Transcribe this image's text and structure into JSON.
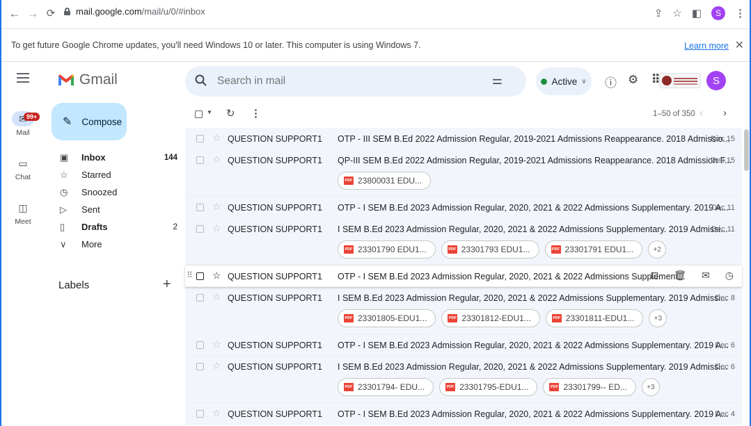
{
  "browser": {
    "url_host": "mail.google.com",
    "url_path": "/mail/u/0/#inbox",
    "profile_initial": "S"
  },
  "infobar": {
    "message": "To get future Google Chrome updates, you'll need Windows 10 or later. This computer is using Windows 7.",
    "learn_more": "Learn more"
  },
  "header": {
    "app_name": "Gmail",
    "search_placeholder": "Search in mail",
    "status": "Active",
    "avatar_initial": "S"
  },
  "rail": {
    "mail_label": "Mail",
    "mail_badge": "99+",
    "chat_label": "Chat",
    "meet_label": "Meet"
  },
  "sidebar": {
    "compose": "Compose",
    "items": [
      {
        "label": "Inbox",
        "count": "144",
        "icon": "inbox-icon"
      },
      {
        "label": "Starred",
        "count": "",
        "icon": "star-icon"
      },
      {
        "label": "Snoozed",
        "count": "",
        "icon": "clock-icon"
      },
      {
        "label": "Sent",
        "count": "",
        "icon": "send-icon"
      },
      {
        "label": "Drafts",
        "count": "2",
        "icon": "draft-icon"
      },
      {
        "label": "More",
        "count": "",
        "icon": "chevron-down-icon"
      }
    ],
    "labels_heading": "Labels"
  },
  "toolbar": {
    "page_count": "1–50 of 350"
  },
  "emails": [
    {
      "sender": "QUESTION SUPPORT1",
      "subject": "OTP - III SEM B.Ed 2022 Admission Regular, 2019-2021 Admissions Reappearance. 2018 Admissio...",
      "date": "Dec 15",
      "attachments": [],
      "more": ""
    },
    {
      "sender": "QUESTION SUPPORT1",
      "subject": "QP-III SEM B.Ed 2022 Admission Regular, 2019-2021 Admissions Reappearance. 2018 Admission F...",
      "date": "Dec 15",
      "attachments": [
        "23800031 EDU..."
      ],
      "more": ""
    },
    {
      "sender": "QUESTION SUPPORT1",
      "subject": "OTP - I SEM B.Ed 2023 Admission Regular, 2020, 2021 & 2022 Admissions Supplementary. 2019 A...",
      "date": "Dec 11",
      "attachments": [],
      "more": ""
    },
    {
      "sender": "QUESTION SUPPORT1",
      "subject": "I SEM B.Ed 2023 Admission Regular, 2020, 2021 & 2022 Admissions Supplementary. 2019 Admissi...",
      "date": "Dec 11",
      "attachments": [
        "23301790 EDU1...",
        "23301793 EDU1...",
        "23301791 EDU1..."
      ],
      "more": "+2"
    },
    {
      "sender": "QUESTION SUPPORT1",
      "subject": "OTP - I SEM B.Ed 2023 Admission Regular, 2020, 2021 & 2022 Admissions Supplement...",
      "date": "",
      "attachments": [],
      "more": "",
      "hover": true
    },
    {
      "sender": "QUESTION SUPPORT1",
      "subject": "I SEM B.Ed 2023 Admission Regular, 2020, 2021 & 2022 Admissions Supplementary. 2019 Admissi...",
      "date": "Dec 8",
      "attachments": [
        "23301805-EDU1...",
        "23301812-EDU1...",
        "23301811-EDU1..."
      ],
      "more": "+3"
    },
    {
      "sender": "QUESTION SUPPORT1",
      "subject": "OTP - I SEM B.Ed 2023 Admission Regular, 2020, 2021 & 2022 Admissions Supplementary. 2019 A...",
      "date": "Dec 6",
      "attachments": [],
      "more": ""
    },
    {
      "sender": "QUESTION SUPPORT1",
      "subject": "I SEM B.Ed 2023 Admission Regular, 2020, 2021 & 2022 Admissions Supplementary. 2019 Admissi...",
      "date": "Dec 6",
      "attachments": [
        "23301794- EDU...",
        "23301795-EDU1...",
        "23301799-- ED..."
      ],
      "more": "+3"
    },
    {
      "sender": "QUESTION SUPPORT1",
      "subject": "OTP - I SEM B.Ed 2023 Admission Regular, 2020, 2021 & 2022 Admissions Supplementary. 2019 A...",
      "date": "Dec 4",
      "attachments": [],
      "more": ""
    }
  ]
}
